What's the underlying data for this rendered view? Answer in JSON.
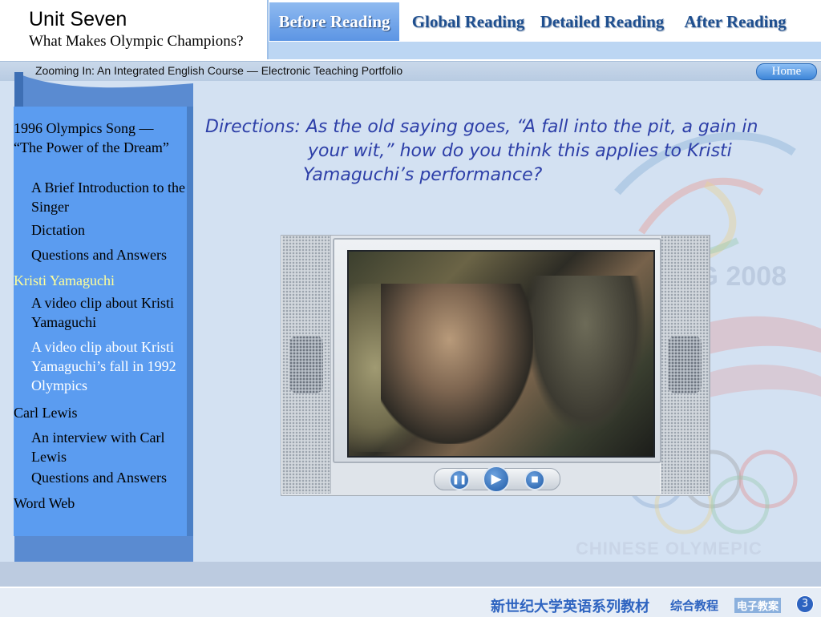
{
  "header": {
    "unit_title": "Unit Seven",
    "unit_subtitle": "What Makes Olympic Champions?",
    "tabs": [
      {
        "label": "Before Reading",
        "active": true
      },
      {
        "label": "Global Reading",
        "active": false
      },
      {
        "label": "Detailed Reading",
        "active": false
      },
      {
        "label": "After Reading",
        "active": false
      }
    ]
  },
  "course_bar": {
    "title": "Zooming In: An Integrated English Course — Electronic Teaching Portfolio",
    "home_label": "Home"
  },
  "sidebar": {
    "items": [
      {
        "label": "1996 Olympics Song — “The Power of the Dream”",
        "level": 1
      },
      {
        "label": "A Brief Introduction to the Singer",
        "level": 2
      },
      {
        "label": "Dictation",
        "level": 2
      },
      {
        "label": "Questions and Answers",
        "level": 2
      },
      {
        "label": "Kristi Yamaguchi",
        "level": 1,
        "highlighted": true
      },
      {
        "label": "A video clip about Kristi Yamaguchi",
        "level": 2
      },
      {
        "label": "A video clip about Kristi Yamaguchi’s fall in 1992 Olympics",
        "level": 2,
        "selected": true
      },
      {
        "label": "Carl Lewis",
        "level": 1
      },
      {
        "label": "An interview with Carl Lewis",
        "level": 2
      },
      {
        "label": "Questions and Answers",
        "level": 2
      },
      {
        "label": "Word Web",
        "level": 1
      }
    ]
  },
  "main": {
    "directions": [
      "Directions: As the old saying goes, “A fall into the pit, a gain in",
      "your wit,” how do you think this applies to Kristi",
      "Yamaguchi’s performance?"
    ]
  },
  "player": {
    "controls": [
      "pause",
      "play",
      "stop"
    ]
  },
  "background": {
    "watermark_year": "IG 2008",
    "committee": "CHINESE OLYMEPIC CMMITTEE"
  },
  "footer": {
    "brand": "新世纪大学英语系列教材",
    "course": "综合教程",
    "portfolio": "电子教案",
    "page_number": "3"
  },
  "colors": {
    "sidebar": "#5b9cf0",
    "active_tab": "#5c95e4",
    "directions_text": "#2d3fa8",
    "highlight": "#ffff99",
    "footer_brand": "#2d63c0"
  }
}
